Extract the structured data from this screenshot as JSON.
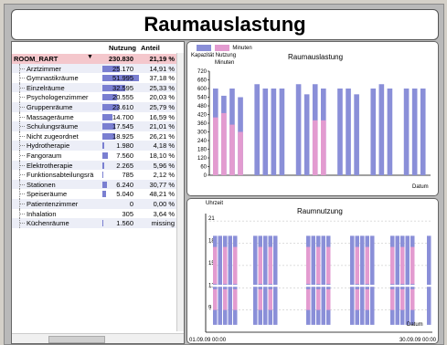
{
  "title": "Raumauslastung",
  "table": {
    "headers": {
      "name": "",
      "nutzung": "Nutzung",
      "anteil": "Anteil"
    },
    "total": {
      "name": "ROOM_RART",
      "nutzung": "230.830",
      "anteil": "21,19 %"
    },
    "rows": [
      {
        "name": "Arztzimmer",
        "nutzung": "25.170",
        "anteil": "14,91 %",
        "share": 0.48
      },
      {
        "name": "Gymnastikräume",
        "nutzung": "51.995",
        "anteil": "37,18 %",
        "share": 1.0
      },
      {
        "name": "Einzelräume",
        "nutzung": "32.595",
        "anteil": "25,33 %",
        "share": 0.63
      },
      {
        "name": "Psychologenzimmer",
        "nutzung": "20.555",
        "anteil": "20,03 %",
        "share": 0.4
      },
      {
        "name": "Gruppenräume",
        "nutzung": "23.610",
        "anteil": "25,79 %",
        "share": 0.45
      },
      {
        "name": "Massageräume",
        "nutzung": "14.700",
        "anteil": "16,59 %",
        "share": 0.28
      },
      {
        "name": "Schulungsräume",
        "nutzung": "17.545",
        "anteil": "21,01 %",
        "share": 0.34
      },
      {
        "name": "Nicht zugeordnet",
        "nutzung": "18.925",
        "anteil": "26,21 %",
        "share": 0.36
      },
      {
        "name": "Hydrotherapie",
        "nutzung": "1.980",
        "anteil": "4,18 %",
        "share": 0.04
      },
      {
        "name": "Fangoraum",
        "nutzung": "7.560",
        "anteil": "18,10 %",
        "share": 0.15
      },
      {
        "name": "Elektrotherapie",
        "nutzung": "2.265",
        "anteil": "5,96 %",
        "share": 0.04
      },
      {
        "name": "Funktionsabteilungsrä",
        "nutzung": "785",
        "anteil": "2,12 %",
        "share": 0.02
      },
      {
        "name": "Stationen",
        "nutzung": "6.240",
        "anteil": "30,77 %",
        "share": 0.12
      },
      {
        "name": "Speiseräume",
        "nutzung": "5.040",
        "anteil": "48,21 %",
        "share": 0.1
      },
      {
        "name": "Patientenzimmer",
        "nutzung": "0",
        "anteil": "0,00 %",
        "share": 0
      },
      {
        "name": "Inhalation",
        "nutzung": "305",
        "anteil": "3,64 %",
        "share": 0.01
      },
      {
        "name": "Küchenräume",
        "nutzung": "1.560",
        "anteil": "missing",
        "share": 0.03
      }
    ]
  },
  "colors": {
    "kapazitaet": "#8a8fd8",
    "nutzung": "#e39bd0",
    "header_row": "#f4c7cc",
    "bar": "#7a7fd1"
  },
  "chart_data": [
    {
      "type": "bar",
      "title": "Raumauslastung",
      "ylabel": "Minuten",
      "xlabel": "Datum",
      "ylim": [
        0,
        720
      ],
      "yticks": [
        0,
        60,
        120,
        180,
        240,
        300,
        360,
        420,
        480,
        540,
        600,
        660,
        720
      ],
      "legend": [
        "Kapazität",
        "Nutzung",
        "Minuten"
      ],
      "series": [
        {
          "name": "Kapazität",
          "values": [
            600,
            550,
            600,
            540,
            0,
            630,
            600,
            600,
            600,
            0,
            630,
            560,
            630,
            600,
            0,
            600,
            600,
            560,
            0,
            600,
            630,
            600,
            0,
            600,
            600,
            600
          ]
        },
        {
          "name": "Nutzung",
          "values": [
            400,
            430,
            350,
            300,
            0,
            0,
            0,
            0,
            0,
            0,
            0,
            0,
            380,
            380,
            0,
            0,
            0,
            0,
            0,
            0,
            0,
            0,
            0,
            0,
            0,
            0
          ]
        }
      ]
    },
    {
      "type": "bar",
      "title": "Raumnutzung",
      "ylabel": "Uhrzeit",
      "xlabel": "Datum",
      "yticks": [
        9,
        12,
        15,
        18,
        21
      ],
      "xticks": [
        "01.09.09 00:00",
        "30.09.09 00:00"
      ]
    }
  ]
}
